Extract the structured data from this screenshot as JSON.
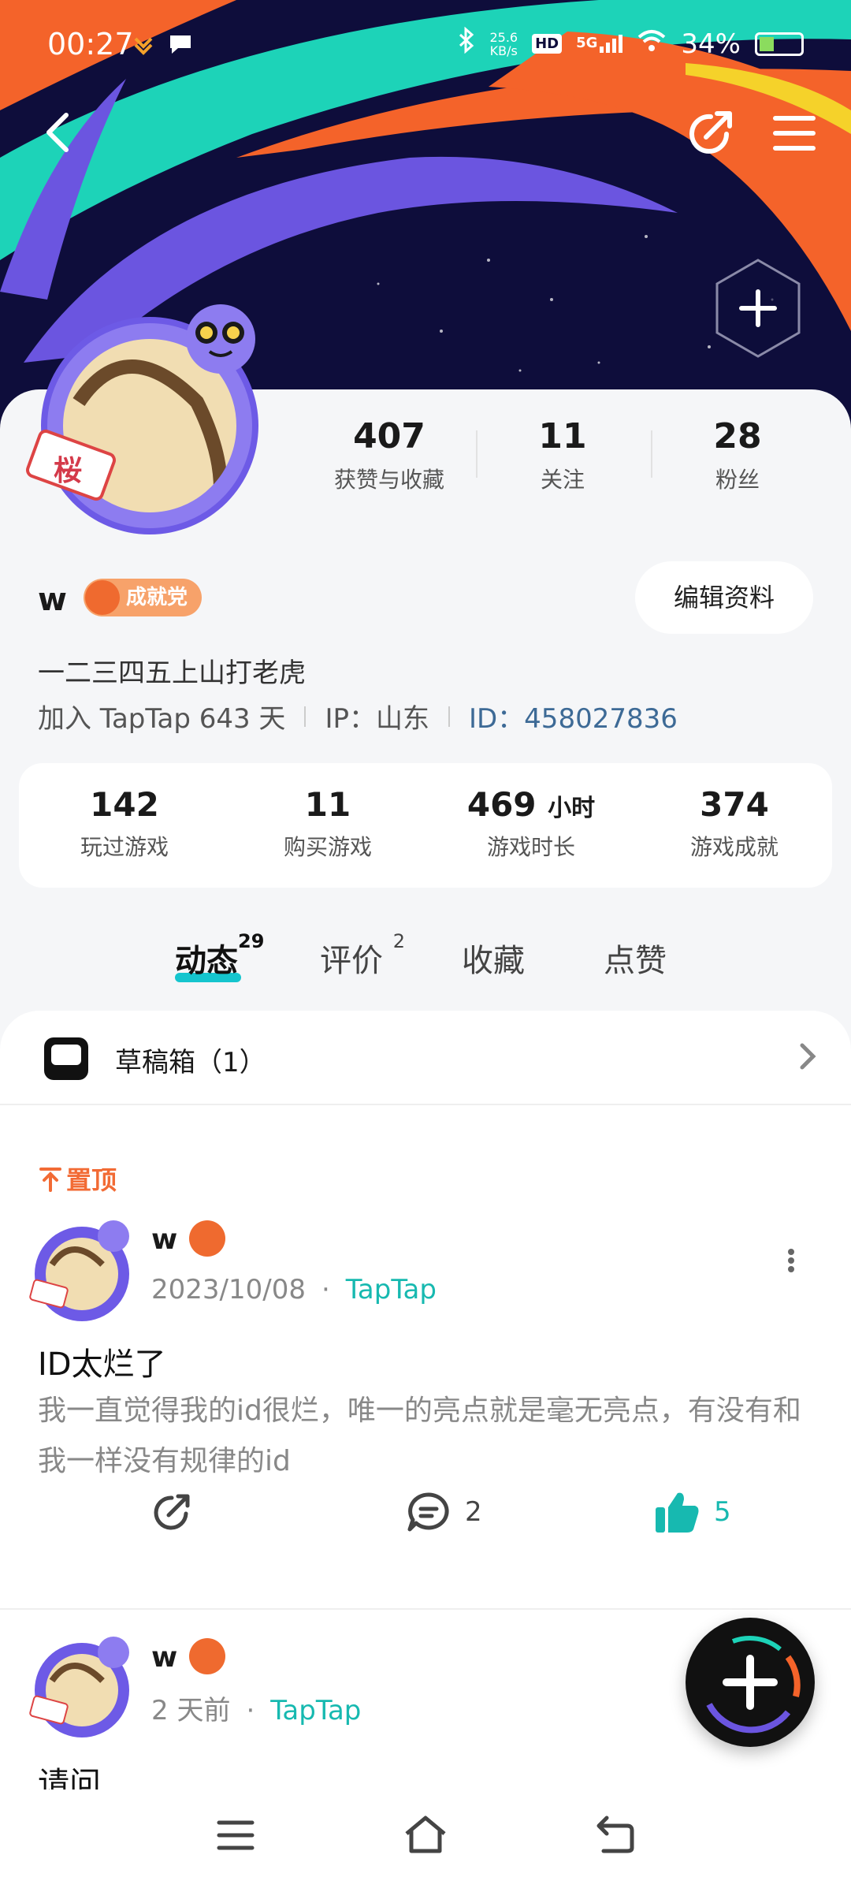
{
  "status_bar": {
    "time": "00:27",
    "net_speed": "25.6",
    "net_unit": "KB/s",
    "hd": "HD",
    "network": "5G",
    "battery": "34%"
  },
  "stats": [
    {
      "value": "407",
      "label": "获赞与收藏"
    },
    {
      "value": "11",
      "label": "关注"
    },
    {
      "value": "28",
      "label": "粉丝"
    }
  ],
  "profile": {
    "name": "w",
    "badge": "成就党",
    "edit_label": "编辑资料",
    "bio": "一二三四五上山打老虎",
    "joined": "加入 TapTap 643 天",
    "ip": "IP：山东",
    "id": "ID：458027836",
    "avatar_tag": "桜"
  },
  "game_stats": [
    {
      "value": "142",
      "unit": "",
      "label": "玩过游戏"
    },
    {
      "value": "11",
      "unit": "",
      "label": "购买游戏"
    },
    {
      "value": "469",
      "unit": "小时",
      "label": "游戏时长"
    },
    {
      "value": "374",
      "unit": "",
      "label": "游戏成就"
    }
  ],
  "tabs": [
    {
      "label": "动态",
      "count": "29"
    },
    {
      "label": "评价",
      "count": "2"
    },
    {
      "label": "收藏",
      "count": ""
    },
    {
      "label": "点赞",
      "count": ""
    }
  ],
  "drafts": {
    "label": "草稿箱（1）"
  },
  "posts": [
    {
      "pinned": "置顶",
      "name": "w",
      "date": "2023/10/08",
      "dot": "·",
      "source": "TapTap",
      "title": "ID太烂了",
      "body": "我一直觉得我的id很烂，唯一的亮点就是毫无亮点，有没有和我一样没有规律的id",
      "comments": "2",
      "likes": "5"
    },
    {
      "name": "w",
      "date": "2 天前",
      "dot": "·",
      "source": "TapTap",
      "title": "请问"
    }
  ],
  "colors": {
    "accent_teal": "#15c5ce",
    "badge_orange": "#f7a26a",
    "pinned_orange": "#f26b35",
    "id_blue": "#3d6a96"
  }
}
